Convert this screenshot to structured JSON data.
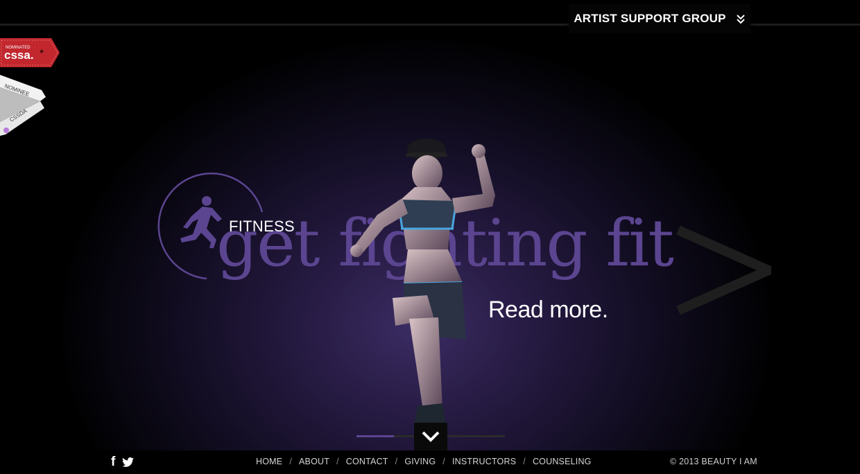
{
  "header": {
    "menu_label": "ARTIST SUPPORT GROUP"
  },
  "badges": {
    "cssa": {
      "top_text": "NOMINATED",
      "main_text": "cssa.",
      "color": "#c1272d"
    },
    "cssda": {
      "line1": "NOMINEE",
      "line2": "CSSDA"
    }
  },
  "slide": {
    "category": "FITNESS",
    "headline": "get fighting fit",
    "read_more": "Read more.",
    "accent_color": "#5b4590",
    "progress": 0.25
  },
  "footer": {
    "social": {
      "facebook": "f",
      "twitter_icon": "twitter-icon"
    },
    "nav": [
      "HOME",
      "ABOUT",
      "CONTACT",
      "GIVING",
      "INSTRUCTORS",
      "COUNSELING"
    ],
    "separator": "/",
    "copyright": "© 2013 BEAUTY I AM"
  }
}
